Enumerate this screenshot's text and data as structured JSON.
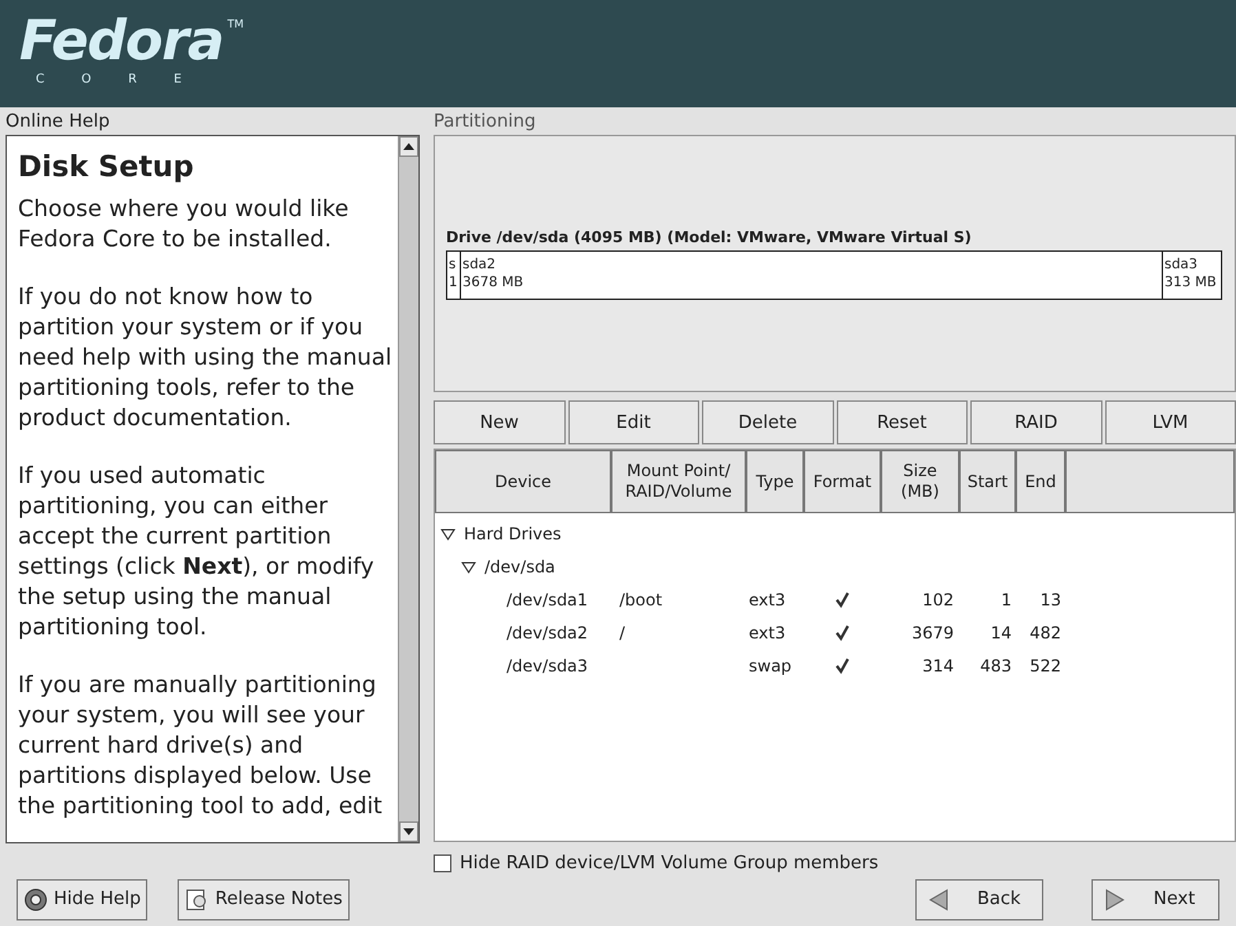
{
  "header": {
    "logo": "Fedora",
    "logo_sub": "C O R E",
    "trademark": "TM"
  },
  "help": {
    "label": "Online Help",
    "title": "Disk Setup",
    "paragraphs": [
      "Choose where you would like Fedora Core to be installed.",
      "If you do not know how to partition your system or if you need help with using the manual partitioning tools, refer to the product documentation.",
      "If you used automatic partitioning, you can either accept the current partition settings (click **Next**), or modify the setup using the manual partitioning tool.",
      "If you are manually partitioning your system, you will see your current hard drive(s) and partitions displayed below. Use the partitioning tool to add, edit"
    ]
  },
  "partitioning": {
    "label": "Partitioning",
    "drive_title": "Drive /dev/sda (4095 MB) (Model: VMware, VMware Virtual S)",
    "segments": [
      {
        "name": "s",
        "size": "1"
      },
      {
        "name": "sda2",
        "size": "3678 MB"
      },
      {
        "name": "sda3",
        "size": "313 MB"
      }
    ],
    "buttons": [
      "New",
      "Edit",
      "Delete",
      "Reset",
      "RAID",
      "LVM"
    ],
    "columns": [
      "Device",
      "Mount Point/ RAID/Volume",
      "Type",
      "Format",
      "Size (MB)",
      "Start",
      "End"
    ],
    "tree": [
      {
        "label": "Hard Drives",
        "expanded": true,
        "children": [
          {
            "label": "/dev/sda",
            "expanded": true,
            "children": [
              {
                "device": "/dev/sda1",
                "mount": "/boot",
                "type": "ext3",
                "format": true,
                "size": "102",
                "start": "1",
                "end": "13"
              },
              {
                "device": "/dev/sda2",
                "mount": "/",
                "type": "ext3",
                "format": true,
                "size": "3679",
                "start": "14",
                "end": "482"
              },
              {
                "device": "/dev/sda3",
                "type": "swap",
                "format": true,
                "size": "314",
                "start": "483",
                "end": "522"
              }
            ]
          }
        ]
      }
    ],
    "hide_members": {
      "label": "Hide RAID device/LVM Volume Group members",
      "checked": false
    }
  },
  "footer": {
    "left_buttons": [
      {
        "label": "Hide Help",
        "kind": "help"
      },
      {
        "label": "Release Notes",
        "kind": "notes"
      }
    ],
    "right_buttons": [
      {
        "label": "Back",
        "kind": "back"
      },
      {
        "label": "Next",
        "kind": "next"
      }
    ]
  }
}
